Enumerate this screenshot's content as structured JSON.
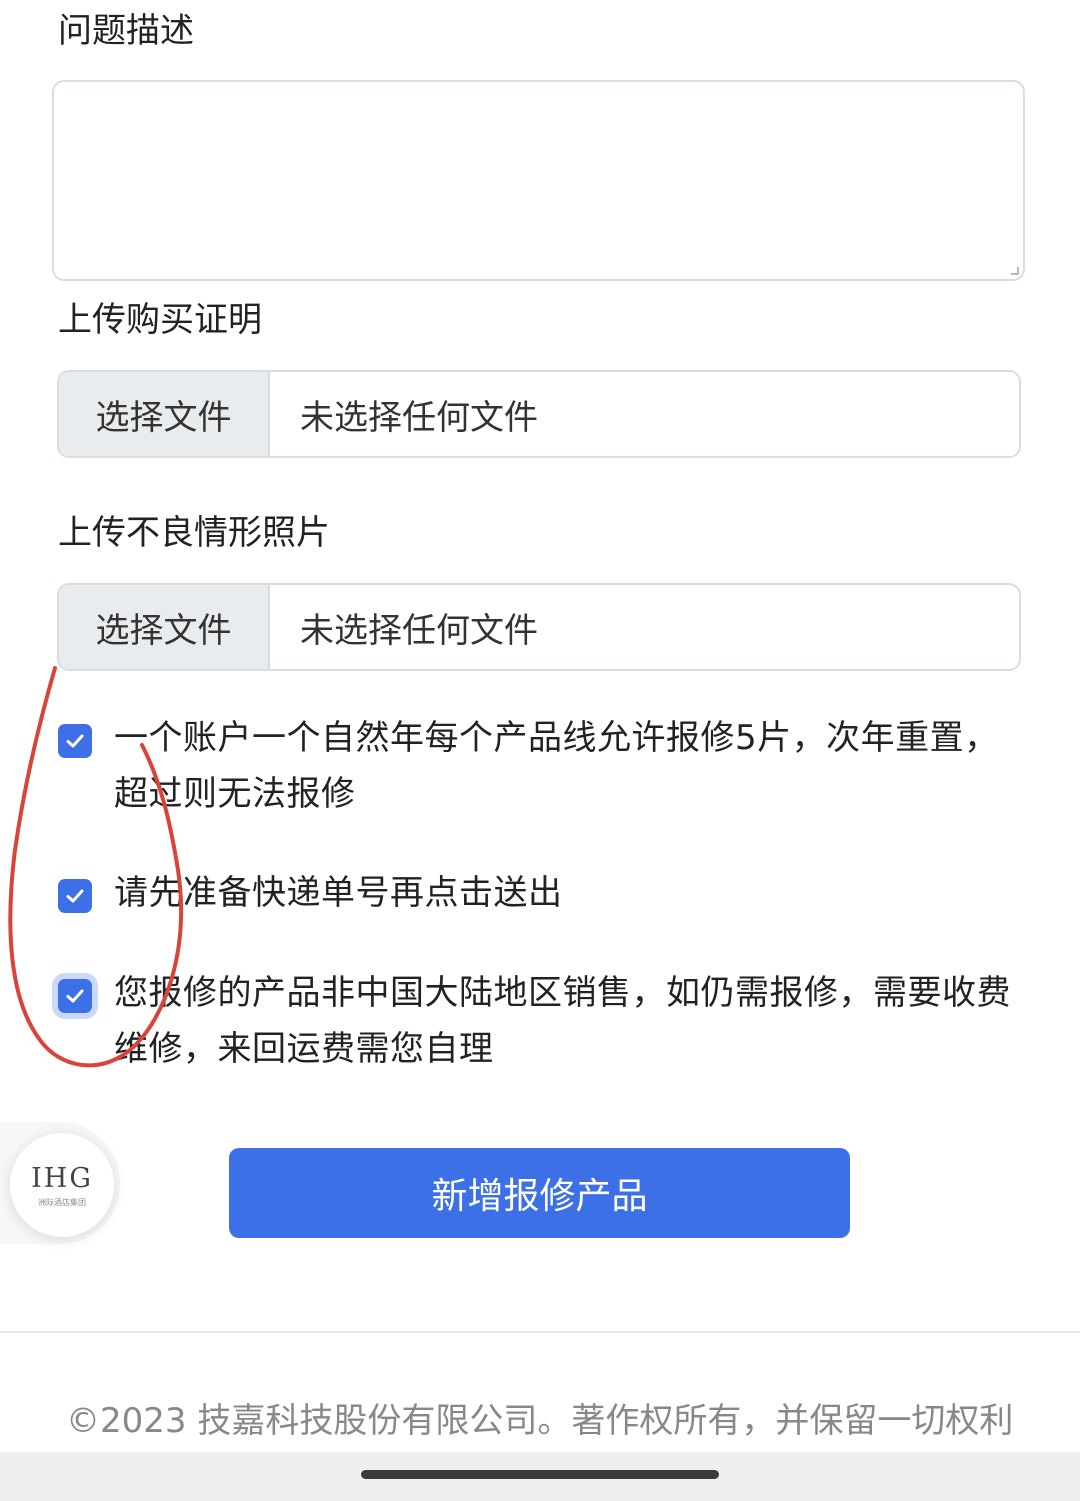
{
  "form": {
    "description_label": "问题描述",
    "purchase_proof_label": "上传购买证明",
    "defect_photo_label": "上传不良情形照片",
    "file_button_label": "选择文件",
    "no_file_text": "未选择任何文件"
  },
  "checks": [
    {
      "text": "一个账户一个自然年每个产品线允许报修5片，次年重置，超过则无法报修",
      "checked": true
    },
    {
      "text": "请先准备快递单号再点击送出",
      "checked": true
    },
    {
      "text": "您报修的产品非中国大陆地区销售，如仍需报修，需要收费维修，来回运费需您自理",
      "checked": true
    }
  ],
  "brand": {
    "logo_text": "IHG",
    "logo_subtext": "洲际酒店集团"
  },
  "actions": {
    "add_repair_label": "新增报修产品"
  },
  "footer": {
    "copyright": "©2023 技嘉科技股份有限公司。著作权所有，并保留一切权利"
  },
  "colors": {
    "accent": "#3d6fe6",
    "annotation": "#d9443a"
  }
}
